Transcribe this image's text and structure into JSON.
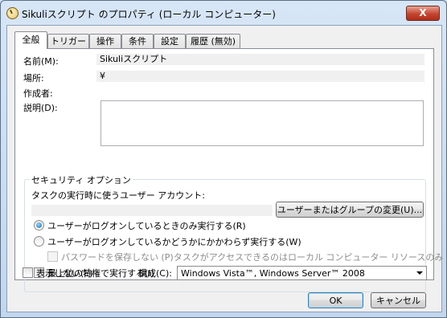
{
  "window": {
    "title": "Sikuliスクリプト のプロパティ (ローカル コンピューター)",
    "close_glyph": "X"
  },
  "tabs": [
    {
      "label": "全般",
      "active": true
    },
    {
      "label": "トリガー"
    },
    {
      "label": "操作"
    },
    {
      "label": "条件"
    },
    {
      "label": "設定"
    },
    {
      "label": "履歴 (無効)"
    }
  ],
  "general": {
    "name_label": "名前(M):",
    "name_value": "Sikuliスクリプト",
    "location_label": "場所:",
    "location_value": "¥",
    "author_label": "作成者:",
    "author_value": "",
    "description_label": "説明(D):",
    "description_value": ""
  },
  "security": {
    "group_title": "セキュリティ オプション",
    "account_label": "タスクの実行時に使うユーザー アカウント:",
    "account_value": "",
    "change_user_button": "ユーザーまたはグループの変更(U)...",
    "radio_logged_on_only": "ユーザーがログオンしているときのみ実行する(R)",
    "radio_whether_logged_on": "ユーザーがログオンしているかどうかにかかわらず実行する(W)",
    "no_store_password": "パスワードを保存しない (P)タスクがアクセスできるのはローカル コンピューター リソースのみ",
    "highest_privileges": "最上位の特権で実行する(I)"
  },
  "bottom": {
    "hidden_label": "表示しない(E)",
    "configure_label": "構成(C):",
    "configure_value": "Windows Vista™, Windows Server™ 2008"
  },
  "buttons": {
    "ok": "OK",
    "cancel": "キャンセル"
  }
}
